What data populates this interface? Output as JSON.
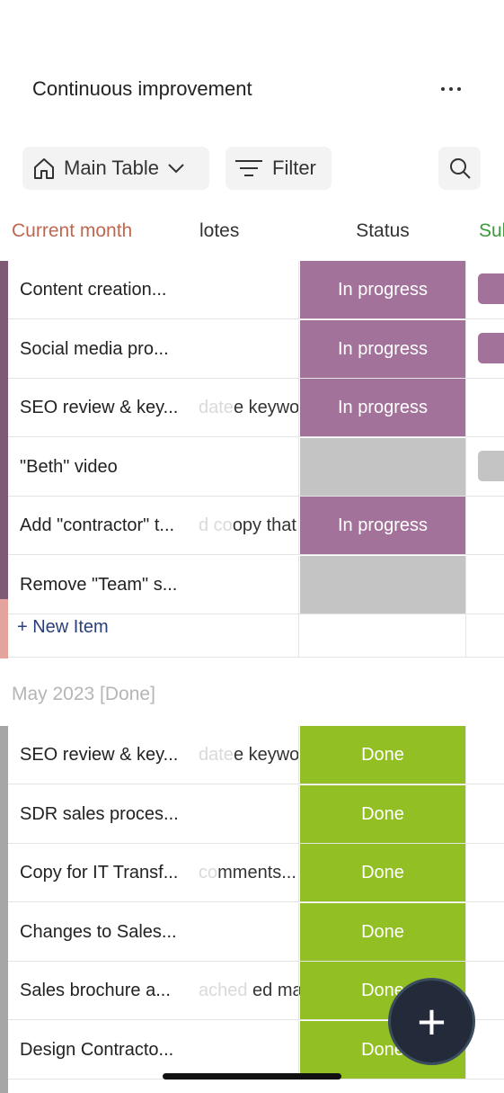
{
  "header": {
    "title": "Continuous improvement",
    "more_icon": "more-horizontal-icon"
  },
  "toolbar": {
    "view_label": "Main Table",
    "view_icon": "home-icon",
    "view_chevron": "chevron-down-icon",
    "filter_label": "Filter",
    "filter_icon": "filter-lines-icon",
    "search_icon": "search-icon"
  },
  "columns": {
    "group": "Current month",
    "notes": "lotes",
    "status": "Status",
    "sub": "Sul"
  },
  "groups": [
    {
      "title": "Current month",
      "color": "#7e5a74",
      "items": [
        {
          "name": "Content creation...",
          "notes_faded": "",
          "notes": "",
          "status": "In progress",
          "status_color": "#a3729a",
          "sub_color": "#a3729a"
        },
        {
          "name": "Social media pro...",
          "notes_faded": "",
          "notes": "",
          "status": "In progress",
          "status_color": "#a3729a",
          "sub_color": "#a3729a"
        },
        {
          "name": "SEO review & key...",
          "notes_faded": "date",
          "notes": "e keywor...",
          "status": "In progress",
          "status_color": "#a3729a",
          "sub_color": ""
        },
        {
          "name": "\"Beth\" video",
          "notes_faded": "",
          "notes": "",
          "status": "",
          "status_color": "#c4c4c4",
          "sub_color": "#c4c4c4"
        },
        {
          "name": "Add \"contractor\" t...",
          "notes_faded": "d co",
          "notes": "opy that l...",
          "status": "In progress",
          "status_color": "#a3729a",
          "sub_color": ""
        },
        {
          "name": "Remove \"Team\" s...",
          "notes_faded": "",
          "notes": "",
          "status": "",
          "status_color": "#c4c4c4",
          "sub_color": ""
        }
      ],
      "new_item_label": "+ New Item"
    },
    {
      "title": "May 2023 [Done]",
      "color": "#a6a6a6",
      "items": [
        {
          "name": "SEO review & key...",
          "notes_faded": "date",
          "notes": "e keywor...",
          "status": "Done",
          "status_color": "#92c024"
        },
        {
          "name": "SDR sales proces...",
          "notes_faded": "",
          "notes": "",
          "status": "Done",
          "status_color": "#92c024"
        },
        {
          "name": "Copy for IT Transf...",
          "notes_faded": "co",
          "notes": "mments...",
          "status": "Done",
          "status_color": "#92c024"
        },
        {
          "name": "Changes to Sales...",
          "notes_faded": "",
          "notes": "",
          "status": "Done",
          "status_color": "#92c024"
        },
        {
          "name": "Sales brochure a...",
          "notes_faded": "ached",
          "notes": " ed marku...",
          "status": "Done",
          "status_color": "#92c024"
        },
        {
          "name": "Design Contracto...",
          "notes_faded": "",
          "notes": "",
          "status": "Done",
          "status_color": "#92c024"
        }
      ]
    }
  ],
  "fab": {
    "icon": "plus-icon",
    "label": "+"
  }
}
